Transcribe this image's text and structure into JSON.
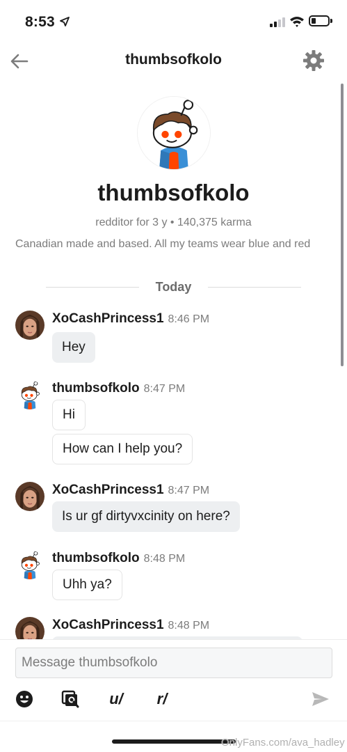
{
  "status_bar": {
    "time": "8:53",
    "location_icon": "location-arrow-icon",
    "signal_icon": "signal-icon",
    "wifi_icon": "wifi-icon",
    "battery_icon": "battery-icon",
    "battery_level": 0.25
  },
  "header": {
    "title": "thumbsofkolo",
    "back_icon": "arrow-left-icon",
    "settings_icon": "gear-icon"
  },
  "profile": {
    "name": "thumbsofkolo",
    "meta": "redditor for 3 y • 140,375 karma",
    "bio": "Canadian made and based. All my teams wear blue and red"
  },
  "divider": {
    "label": "Today"
  },
  "messages": [
    {
      "author": "XoCashPrincess1",
      "time": "8:46 PM",
      "bubbles": [
        "Hey"
      ]
    },
    {
      "author": "thumbsofkolo",
      "time": "8:47 PM",
      "bubbles": [
        "Hi",
        "How can I help you?"
      ]
    },
    {
      "author": "XoCashPrincess1",
      "time": "8:47 PM",
      "bubbles": [
        "Is ur gf dirtyvxcinity on here?"
      ]
    },
    {
      "author": "thumbsofkolo",
      "time": "8:48 PM",
      "bubbles": [
        "Uhh ya?"
      ]
    },
    {
      "author": "XoCashPrincess1",
      "time": "8:48 PM",
      "bubbles": []
    }
  ],
  "composer": {
    "placeholder": "Message thumbsofkolo",
    "emoji_icon": "emoji-icon",
    "gif_search_icon": "image-search-icon",
    "user_label": "u/",
    "subreddit_label": "r/",
    "send_icon": "send-icon"
  },
  "watermark": "OnlyFans.com/ava_hadley",
  "colors": {
    "accent_blue": "#0079d3",
    "avatar_orange": "#ff4500",
    "bubble_gray": "#edeff1"
  }
}
